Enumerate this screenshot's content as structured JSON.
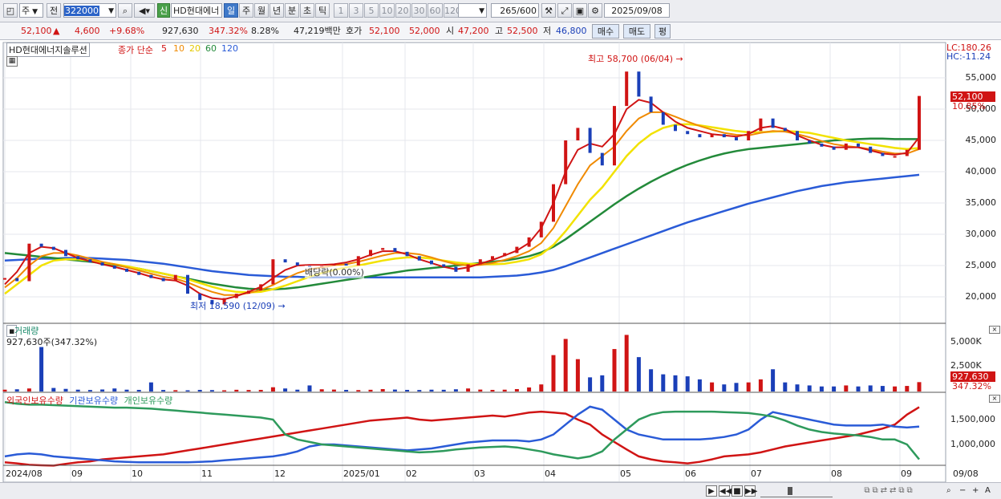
{
  "toolbar": {
    "period_label": "주",
    "prev_label": "전",
    "code": "322000",
    "badge": "신",
    "name": "HD현대에너",
    "periods": [
      "일",
      "주",
      "월",
      "년",
      "분",
      "초",
      "틱"
    ],
    "minutes": [
      "1",
      "3",
      "5",
      "10",
      "20",
      "30",
      "60",
      "120"
    ],
    "count": "265",
    "count_total": "/600",
    "date": "2025/09/08"
  },
  "quote": {
    "price": "52,100",
    "arrow": "▲",
    "change": "4,600",
    "change_pct": "+9.68%",
    "volume": "927,630",
    "volume_ratio": "347.32%",
    "turnover": "8.28%",
    "amount": "47,219백만",
    "ask_label": "호가",
    "ask": "52,100",
    "bid": "52,000",
    "open_label": "시",
    "open": "47,200",
    "high_label": "고",
    "high": "52,500",
    "low_label": "저",
    "low": "46,800",
    "buy_label": "매수",
    "sell_label": "매도",
    "eval_label": "평"
  },
  "chart_data": [
    {
      "type": "line",
      "title": "HD현대에너지솔루션",
      "subtitle": "종가 단순",
      "ma_periods": [
        "5",
        "10",
        "20",
        "60",
        "120"
      ],
      "ylim": [
        17000,
        60000
      ],
      "y_ticks": [
        "55,000",
        "50,000",
        "45,000",
        "40,000",
        "35,000",
        "30,000",
        "25,000",
        "20,000"
      ],
      "x_ticks": [
        "2024/08",
        "09",
        "10",
        "11",
        "12",
        "2025/01",
        "02",
        "03",
        "04",
        "05",
        "06",
        "07",
        "08",
        "09",
        "09/08"
      ],
      "close": [
        23000,
        22500,
        28500,
        28000,
        27500,
        26500,
        26000,
        25500,
        25000,
        24500,
        24000,
        23500,
        23000,
        22500,
        23500,
        20500,
        19500,
        18800,
        19800,
        20500,
        21000,
        22000,
        26000,
        25500,
        25000,
        24800,
        25000,
        25300,
        25000,
        26500,
        27500,
        27800,
        27200,
        26500,
        25800,
        25200,
        24800,
        24000,
        25200,
        26000,
        26500,
        27000,
        28000,
        29500,
        32000,
        38000,
        45000,
        47000,
        43000,
        41000,
        50500,
        56000,
        52000,
        49500,
        47500,
        46500,
        46000,
        45500,
        46000,
        45500,
        45000,
        46500,
        48500,
        47000,
        46500,
        45000,
        44500,
        44000,
        43500,
        44500,
        44000,
        43000,
        42500,
        42500,
        43500,
        52100
      ],
      "ma5": [
        22000,
        24000,
        27000,
        28000,
        27800,
        27000,
        26200,
        25700,
        25200,
        24800,
        24300,
        23800,
        23200,
        22800,
        22600,
        21800,
        20500,
        19800,
        19600,
        20100,
        20800,
        21600,
        23000,
        24300,
        25000,
        25100,
        25100,
        25200,
        25500,
        26000,
        26700,
        27300,
        27300,
        26800,
        26000,
        25400,
        24800,
        24400,
        24700,
        25300,
        25900,
        26600,
        27400,
        28600,
        31000,
        35000,
        40000,
        43500,
        44500,
        44000,
        46000,
        50000,
        51500,
        51000,
        49500,
        48000,
        47000,
        46500,
        46000,
        45800,
        45600,
        46000,
        47000,
        47300,
        46800,
        45800,
        45000,
        44300,
        43900,
        43900,
        43900,
        43400,
        42900,
        42700,
        43000,
        45500
      ],
      "ma10": [
        21500,
        23000,
        25000,
        26500,
        27000,
        27000,
        26600,
        26100,
        25600,
        25200,
        24700,
        24200,
        23700,
        23200,
        22900,
        22300,
        21500,
        20800,
        20300,
        20300,
        20600,
        21100,
        21900,
        22900,
        23800,
        24400,
        24700,
        25000,
        25200,
        25600,
        26100,
        26600,
        27000,
        27000,
        26800,
        26300,
        25700,
        25200,
        25000,
        25100,
        25400,
        25900,
        26500,
        27300,
        28600,
        31000,
        34500,
        38000,
        41000,
        42500,
        44000,
        46500,
        48500,
        49500,
        49500,
        48800,
        48000,
        47300,
        46700,
        46200,
        45900,
        45800,
        46200,
        46500,
        46400,
        46000,
        45500,
        44900,
        44400,
        44100,
        43900,
        43600,
        43200,
        42900,
        42900,
        43600
      ],
      "ma20": [
        20500,
        22000,
        23500,
        25000,
        25800,
        26000,
        26000,
        25800,
        25500,
        25200,
        24900,
        24500,
        24100,
        23700,
        23300,
        22800,
        22200,
        21600,
        21100,
        20800,
        20700,
        20800,
        21200,
        21800,
        22500,
        23200,
        23800,
        24300,
        24700,
        25000,
        25400,
        25800,
        26100,
        26300,
        26300,
        26100,
        25800,
        25500,
        25300,
        25200,
        25200,
        25300,
        25600,
        26000,
        26800,
        28300,
        30500,
        33000,
        35500,
        37500,
        40000,
        42500,
        44500,
        46000,
        47000,
        47500,
        47600,
        47400,
        47100,
        46800,
        46500,
        46300,
        46300,
        46400,
        46500,
        46400,
        46200,
        45800,
        45400,
        45000,
        44700,
        44400,
        44100,
        43800,
        43600,
        43800
      ],
      "ma60": [
        27000,
        26800,
        26600,
        26400,
        26200,
        26000,
        25800,
        25600,
        25400,
        25100,
        24800,
        24500,
        24100,
        23700,
        23300,
        22900,
        22500,
        22100,
        21800,
        21500,
        21300,
        21200,
        21200,
        21300,
        21500,
        21800,
        22100,
        22400,
        22700,
        23000,
        23300,
        23600,
        23900,
        24200,
        24400,
        24600,
        24800,
        25000,
        25200,
        25400,
        25600,
        25800,
        26100,
        26500,
        27100,
        28000,
        29200,
        30600,
        32000,
        33400,
        34800,
        36100,
        37300,
        38400,
        39400,
        40300,
        41100,
        41800,
        42400,
        42900,
        43300,
        43600,
        43800,
        44000,
        44200,
        44400,
        44600,
        44800,
        45000,
        45100,
        45200,
        45300,
        45300,
        45200,
        45200,
        45200
      ],
      "ma120": [
        25800,
        25900,
        26000,
        26100,
        26100,
        26200,
        26200,
        26200,
        26100,
        26000,
        25900,
        25700,
        25500,
        25300,
        25000,
        24700,
        24400,
        24100,
        23900,
        23700,
        23500,
        23400,
        23300,
        23200,
        23200,
        23100,
        23100,
        23100,
        23100,
        23100,
        23100,
        23100,
        23100,
        23100,
        23100,
        23100,
        23100,
        23100,
        23100,
        23100,
        23200,
        23300,
        23400,
        23600,
        23900,
        24300,
        24900,
        25600,
        26300,
        27000,
        27700,
        28400,
        29100,
        29800,
        30500,
        31200,
        31900,
        32500,
        33100,
        33700,
        34300,
        34900,
        35400,
        35900,
        36400,
        36900,
        37300,
        37700,
        38000,
        38300,
        38500,
        38700,
        38900,
        39100,
        39300,
        39500
      ],
      "annotations": [
        {
          "label": "최고 58,700 (06/04)",
          "value": 58700
        },
        {
          "label": "최저 18,590 (12/09)",
          "value": 18590
        },
        {
          "label": "배당락(0.00%)"
        }
      ],
      "last_price_label": "52,100",
      "last_change_label": "10.85%",
      "lc": "LC:180.26",
      "hc": "HC:-11.24"
    },
    {
      "type": "bar",
      "title": "거래량",
      "value_label": "927,630주(347.32%)",
      "y_ticks": [
        "5,000K",
        "2,500K"
      ],
      "last_label": "927,630",
      "last_pct": "347.32%",
      "ylim": [
        0,
        6000
      ],
      "values": [
        180,
        220,
        300,
        4400,
        350,
        260,
        180,
        150,
        200,
        300,
        180,
        160,
        900,
        150,
        130,
        120,
        160,
        140,
        120,
        170,
        150,
        160,
        420,
        300,
        180,
        600,
        220,
        190,
        160,
        140,
        170,
        240,
        190,
        160,
        150,
        180,
        170,
        220,
        300,
        190,
        160,
        180,
        240,
        400,
        700,
        3600,
        5200,
        3200,
        1400,
        1600,
        4200,
        5600,
        3400,
        2200,
        1700,
        1600,
        1500,
        1200,
        900,
        700,
        850,
        900,
        1200,
        2200,
        900,
        700,
        600,
        500,
        500,
        600,
        500,
        600,
        550,
        500,
        550,
        927
      ]
    },
    {
      "type": "line",
      "title": "보유수량",
      "series": [
        {
          "name": "외국인보유수량",
          "color": "#d01414",
          "values": [
            640000,
            620000,
            590000,
            580000,
            575000,
            610000,
            640000,
            660000,
            700000,
            720000,
            740000,
            760000,
            780000,
            800000,
            840000,
            880000,
            920000,
            960000,
            1000000,
            1040000,
            1080000,
            1120000,
            1160000,
            1200000,
            1240000,
            1280000,
            1320000,
            1360000,
            1400000,
            1440000,
            1480000,
            1500000,
            1520000,
            1540000,
            1500000,
            1480000,
            1500000,
            1520000,
            1540000,
            1560000,
            1580000,
            1560000,
            1600000,
            1640000,
            1660000,
            1640000,
            1620000,
            1500000,
            1400000,
            1200000,
            1050000,
            900000,
            760000,
            700000,
            660000,
            640000,
            620000,
            650000,
            700000,
            760000,
            780000,
            800000,
            840000,
            900000,
            960000,
            1000000,
            1040000,
            1080000,
            1120000,
            1160000,
            1200000,
            1260000,
            1320000,
            1400000,
            1600000,
            1750000
          ]
        },
        {
          "name": "기관보유수량",
          "color": "#2a5bd7",
          "values": [
            760000,
            800000,
            820000,
            800000,
            760000,
            740000,
            720000,
            700000,
            680000,
            660000,
            650000,
            640000,
            640000,
            640000,
            640000,
            640000,
            650000,
            660000,
            680000,
            700000,
            720000,
            740000,
            760000,
            800000,
            860000,
            960000,
            1000000,
            1000000,
            980000,
            960000,
            940000,
            920000,
            900000,
            880000,
            900000,
            920000,
            960000,
            1000000,
            1040000,
            1060000,
            1080000,
            1080000,
            1080000,
            1060000,
            1100000,
            1200000,
            1400000,
            1600000,
            1760000,
            1700000,
            1500000,
            1300000,
            1200000,
            1150000,
            1100000,
            1100000,
            1100000,
            1100000,
            1120000,
            1150000,
            1200000,
            1300000,
            1500000,
            1650000,
            1600000,
            1550000,
            1500000,
            1450000,
            1400000,
            1380000,
            1380000,
            1380000,
            1400000,
            1360000,
            1340000,
            1360000
          ]
        },
        {
          "name": "개인보유수량",
          "color": "#2e9a5c",
          "values": [
            1850000,
            1820000,
            1800000,
            1800000,
            1790000,
            1780000,
            1770000,
            1760000,
            1750000,
            1740000,
            1740000,
            1730000,
            1720000,
            1700000,
            1680000,
            1660000,
            1640000,
            1620000,
            1600000,
            1580000,
            1560000,
            1540000,
            1500000,
            1200000,
            1100000,
            1050000,
            1000000,
            980000,
            960000,
            940000,
            920000,
            900000,
            880000,
            860000,
            840000,
            850000,
            870000,
            900000,
            920000,
            940000,
            950000,
            960000,
            940000,
            900000,
            860000,
            800000,
            760000,
            720000,
            760000,
            860000,
            1100000,
            1300000,
            1500000,
            1600000,
            1650000,
            1660000,
            1660000,
            1660000,
            1660000,
            1650000,
            1640000,
            1630000,
            1600000,
            1560000,
            1480000,
            1380000,
            1300000,
            1250000,
            1220000,
            1200000,
            1180000,
            1150000,
            1100000,
            1100000,
            1000000,
            700000
          ]
        }
      ],
      "y_ticks": [
        "1,500,000",
        "1,000,000"
      ],
      "ylim": [
        500000,
        2000000
      ]
    }
  ],
  "statusbar": {
    "icons": [
      "play-icon",
      "prev-icon",
      "stop-icon",
      "next-icon"
    ]
  }
}
